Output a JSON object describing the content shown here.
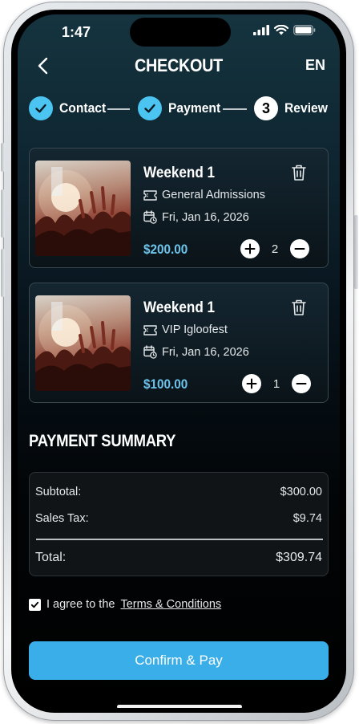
{
  "status_bar": {
    "time": "1:47"
  },
  "nav": {
    "title": "CHECKOUT",
    "language": "EN"
  },
  "stepper": [
    {
      "label": "Contact",
      "state": "done"
    },
    {
      "label": "Payment",
      "state": "done"
    },
    {
      "label": "Review",
      "state": "current",
      "number": "3"
    }
  ],
  "cart": {
    "items": [
      {
        "title": "Weekend 1",
        "ticket_type": "General Admissions",
        "date": "Fri, Jan 16, 2026",
        "price": "$200.00",
        "quantity": "2"
      },
      {
        "title": "Weekend 1",
        "ticket_type": "VIP Igloofest",
        "date": "Fri, Jan 16, 2026",
        "price": "$100.00",
        "quantity": "1"
      }
    ]
  },
  "summary": {
    "heading": "PAYMENT SUMMARY",
    "subtotal_label": "Subtotal:",
    "subtotal_value": "$300.00",
    "tax_label": "Sales Tax:",
    "tax_value": "$9.74",
    "total_label": "Total:",
    "total_value": "$309.74"
  },
  "agreement": {
    "prefix": "I agree to the",
    "link_text": "Terms & Conditions",
    "checked": true
  },
  "confirm_button": "Confirm & Pay",
  "colors": {
    "accent": "#4cc4f2",
    "price": "#6cc4ea",
    "button": "#3aaee8"
  }
}
